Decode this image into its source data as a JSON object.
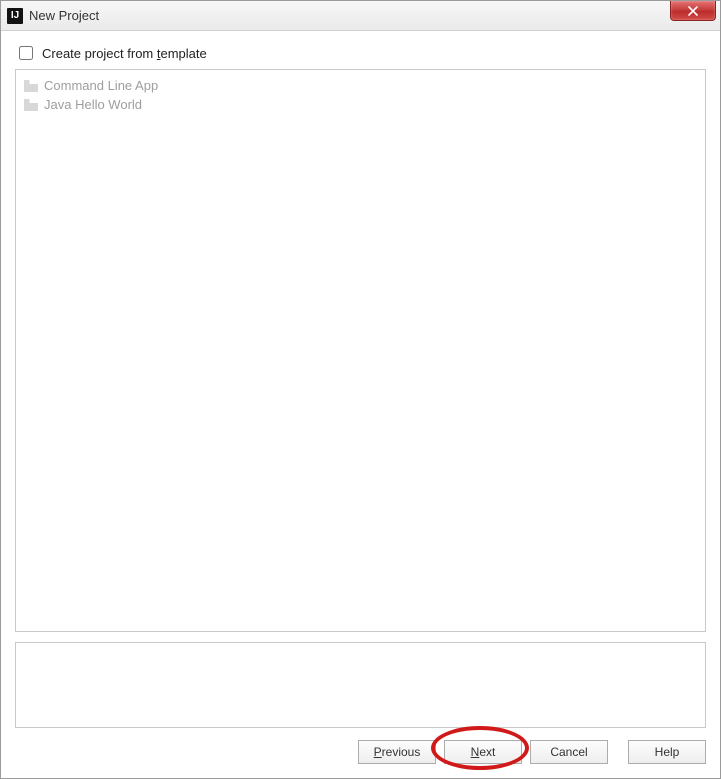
{
  "titlebar": {
    "title": "New Project"
  },
  "checkbox": {
    "label_pre": "Create project from ",
    "label_mnemonic": "t",
    "label_post": "emplate",
    "checked": false
  },
  "templates": [
    {
      "label": "Command Line App"
    },
    {
      "label": "Java Hello World"
    }
  ],
  "buttons": {
    "previous_mnemonic": "P",
    "previous_rest": "revious",
    "next_mnemonic": "N",
    "next_rest": "ext",
    "cancel": "Cancel",
    "help": "Help"
  },
  "highlight": {
    "target": "next-button"
  }
}
